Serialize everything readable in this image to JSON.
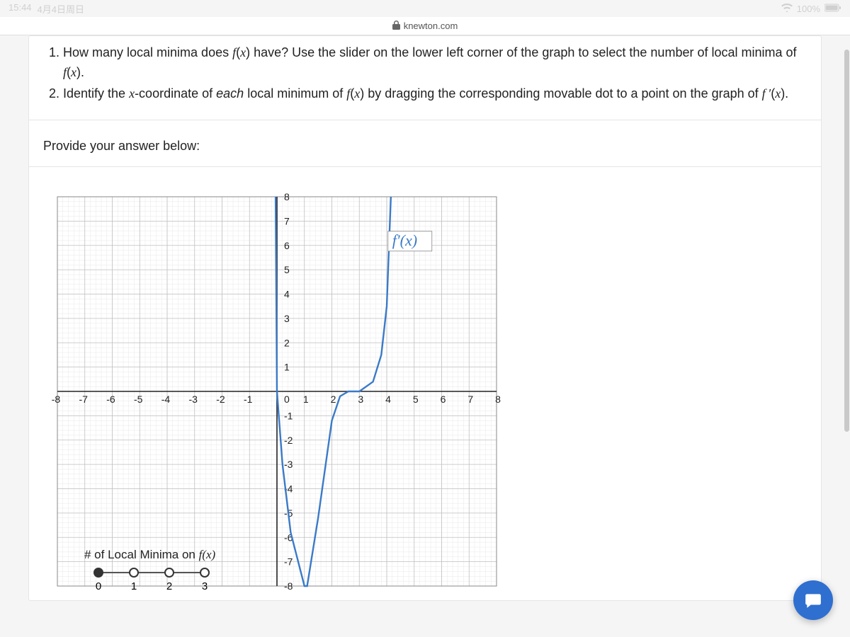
{
  "status": {
    "time": "15:44",
    "date": "4月4日周日",
    "battery": "100%"
  },
  "url": "knewton.com",
  "questions": [
    "How many local minima does f(x) have? Use the slider on the lower left corner of the graph to select the number of local minima of f(x).",
    "Identify the x-coordinate of each local minimum of f(x) by dragging the corresponding movable dot to a point on the graph of f′(x)."
  ],
  "answer_prompt": "Provide your answer below:",
  "slider": {
    "title_prefix": "# of Local Minima on ",
    "title_fn": "f(x)",
    "options": [
      "0",
      "1",
      "2",
      "3"
    ],
    "selected": 0
  },
  "chart_data": {
    "type": "line",
    "title": "",
    "legend": "f′(x)",
    "xlabel": "",
    "ylabel": "",
    "xlim": [
      -8,
      8
    ],
    "ylim": [
      -8,
      8
    ],
    "xticks": [
      -8,
      -7,
      -6,
      -5,
      -4,
      -3,
      -2,
      -1,
      0,
      1,
      2,
      3,
      4,
      5,
      6,
      7,
      8
    ],
    "yticks": [
      -8,
      -7,
      -6,
      -5,
      -4,
      -3,
      -2,
      -1,
      0,
      1,
      2,
      3,
      4,
      5,
      6,
      7,
      8
    ],
    "series": [
      {
        "name": "f′(x)",
        "points": [
          [
            -0.05,
            8
          ],
          [
            0,
            0
          ],
          [
            0.2,
            -3
          ],
          [
            0.5,
            -5.8
          ],
          [
            1,
            -8
          ],
          [
            1.1,
            -8
          ],
          [
            1.5,
            -5.2
          ],
          [
            2,
            -1.2
          ],
          [
            2.3,
            -0.2
          ],
          [
            2.6,
            0
          ],
          [
            3,
            0
          ],
          [
            3.5,
            0.4
          ],
          [
            3.8,
            1.5
          ],
          [
            4,
            3.5
          ],
          [
            4.15,
            8
          ]
        ]
      }
    ],
    "grid": true
  },
  "help_label": "chat"
}
